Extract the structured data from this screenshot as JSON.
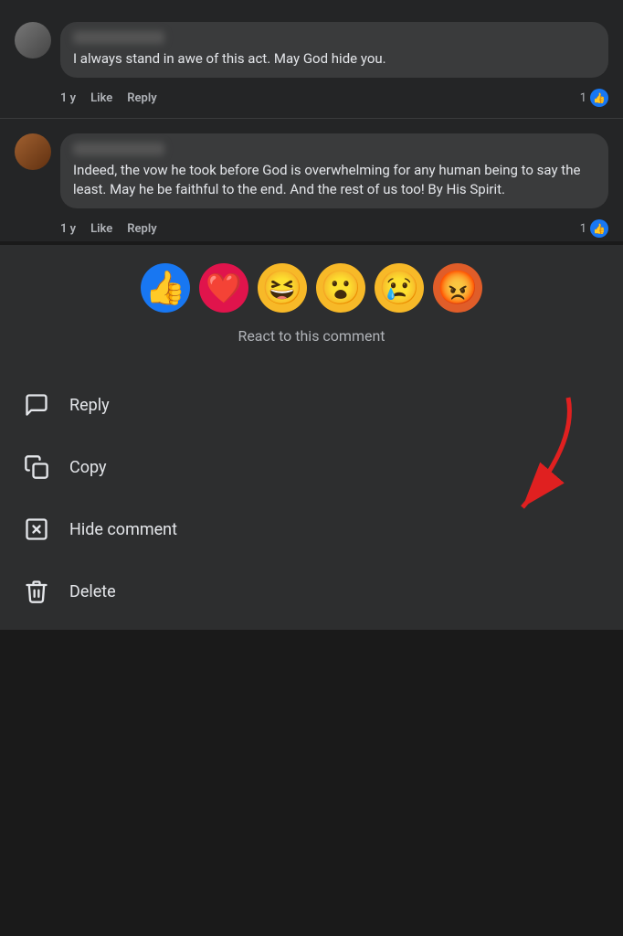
{
  "comments": [
    {
      "id": "comment1",
      "username": "User Name",
      "text": "I always stand in awe of this act. May God hide you.",
      "time": "1 y",
      "likes": "1",
      "actions": [
        "Like",
        "Reply"
      ]
    },
    {
      "id": "comment2",
      "username": "Another User",
      "text": "Indeed, the vow he took before God is overwhelming for any human being to say the least. May he be faithful to the end. And the rest of us too! By His Spirit.",
      "time": "1 y",
      "likes": "1",
      "actions": [
        "Like",
        "Reply"
      ]
    }
  ],
  "reactions": {
    "label": "React to this comment",
    "emojis": [
      {
        "name": "like",
        "emoji": "👍",
        "label": "Like"
      },
      {
        "name": "love",
        "emoji": "❤️",
        "label": "Love"
      },
      {
        "name": "haha",
        "emoji": "😆",
        "label": "Haha"
      },
      {
        "name": "wow",
        "emoji": "😮",
        "label": "Wow"
      },
      {
        "name": "sad",
        "emoji": "😢",
        "label": "Sad"
      },
      {
        "name": "angry",
        "emoji": "😡",
        "label": "Angry"
      }
    ]
  },
  "menu": {
    "items": [
      {
        "id": "reply",
        "label": "Reply",
        "icon": "chat"
      },
      {
        "id": "copy",
        "label": "Copy",
        "icon": "copy"
      },
      {
        "id": "hide",
        "label": "Hide comment",
        "icon": "hide"
      },
      {
        "id": "delete",
        "label": "Delete",
        "icon": "trash"
      }
    ]
  }
}
